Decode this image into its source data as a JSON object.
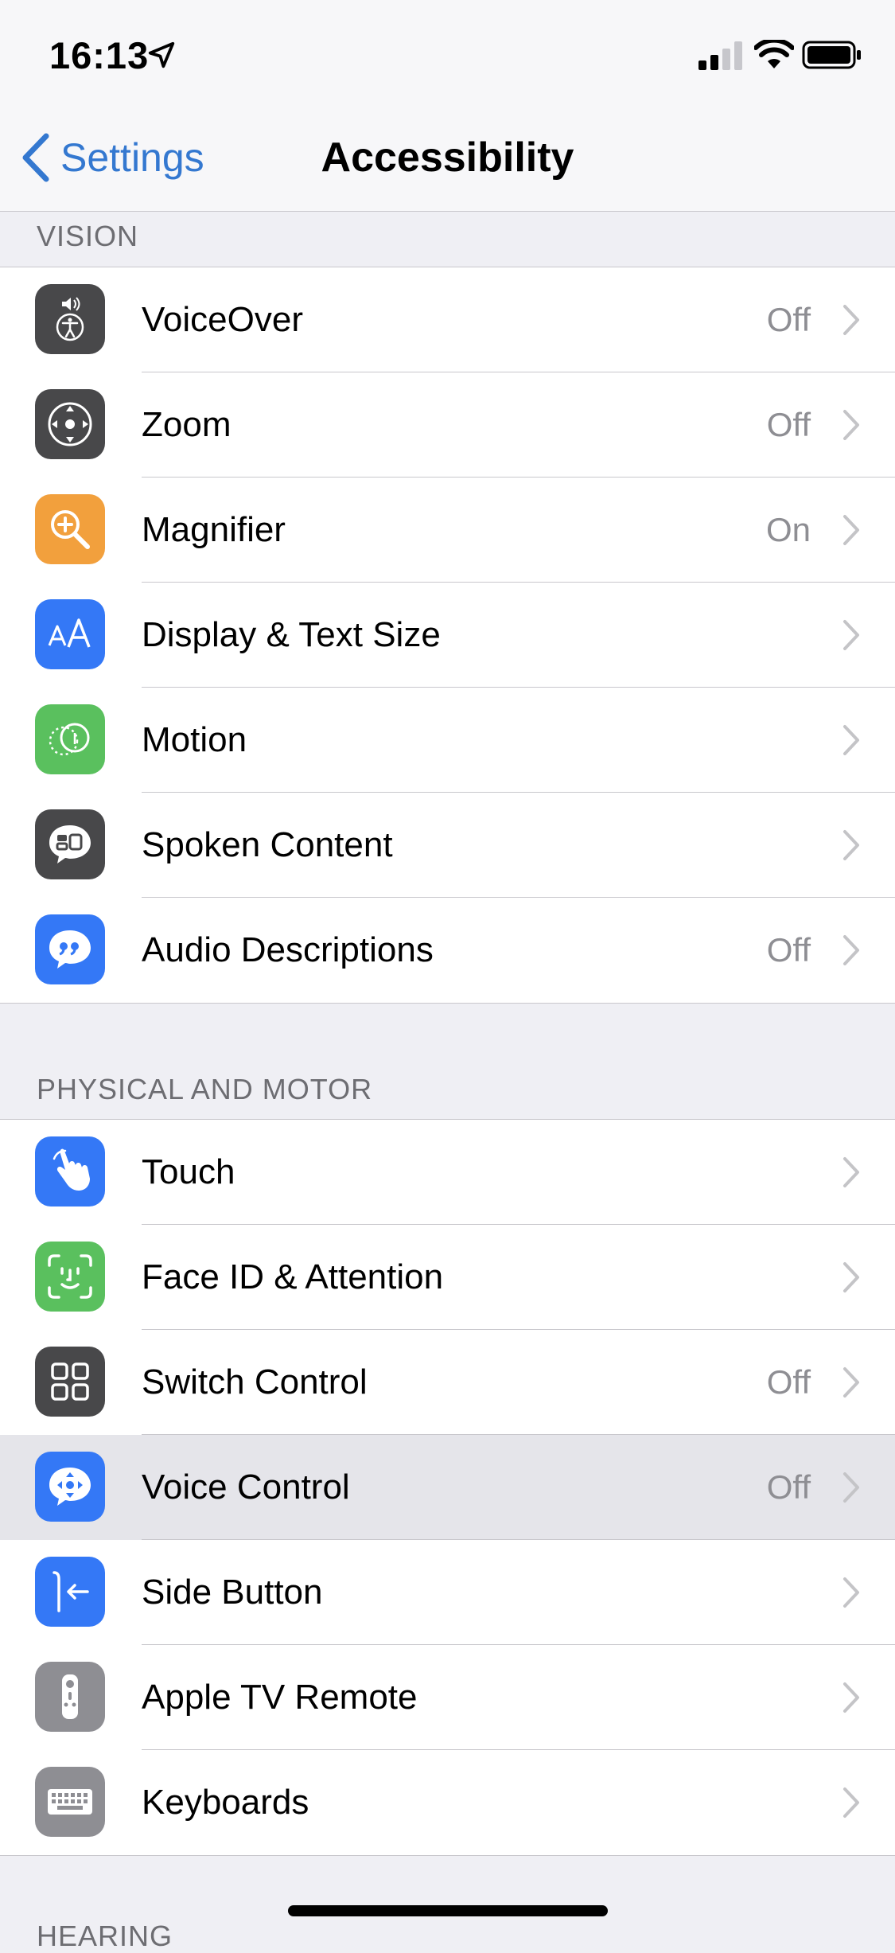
{
  "status_bar": {
    "time": "16:13"
  },
  "nav": {
    "back_label": "Settings",
    "title": "Accessibility"
  },
  "sections": [
    {
      "header": "VISION",
      "items": [
        {
          "label": "VoiceOver",
          "value": "Off",
          "icon": "voiceover-icon",
          "color": "#48484a"
        },
        {
          "label": "Zoom",
          "value": "Off",
          "icon": "zoom-icon",
          "color": "#48484a"
        },
        {
          "label": "Magnifier",
          "value": "On",
          "icon": "magnifier-icon",
          "color": "#f2a03d"
        },
        {
          "label": "Display & Text Size",
          "value": "",
          "icon": "text-size-icon",
          "color": "#3478f6"
        },
        {
          "label": "Motion",
          "value": "",
          "icon": "motion-icon",
          "color": "#5ac05e"
        },
        {
          "label": "Spoken Content",
          "value": "",
          "icon": "spoken-content-icon",
          "color": "#48484a"
        },
        {
          "label": "Audio Descriptions",
          "value": "Off",
          "icon": "audio-descriptions-icon",
          "color": "#3478f6"
        }
      ]
    },
    {
      "header": "PHYSICAL AND MOTOR",
      "items": [
        {
          "label": "Touch",
          "value": "",
          "icon": "touch-icon",
          "color": "#3478f6"
        },
        {
          "label": "Face ID & Attention",
          "value": "",
          "icon": "face-id-icon",
          "color": "#5ac05e"
        },
        {
          "label": "Switch Control",
          "value": "Off",
          "icon": "switch-control-icon",
          "color": "#48484a"
        },
        {
          "label": "Voice Control",
          "value": "Off",
          "icon": "voice-control-icon",
          "color": "#3478f6"
        },
        {
          "label": "Side Button",
          "value": "",
          "icon": "side-button-icon",
          "color": "#3478f6"
        },
        {
          "label": "Apple TV Remote",
          "value": "",
          "icon": "apple-tv-remote-icon",
          "color": "#8e8e93"
        },
        {
          "label": "Keyboards",
          "value": "",
          "icon": "keyboard-icon",
          "color": "#8e8e93"
        }
      ]
    },
    {
      "header": "HEARING",
      "items": []
    }
  ]
}
